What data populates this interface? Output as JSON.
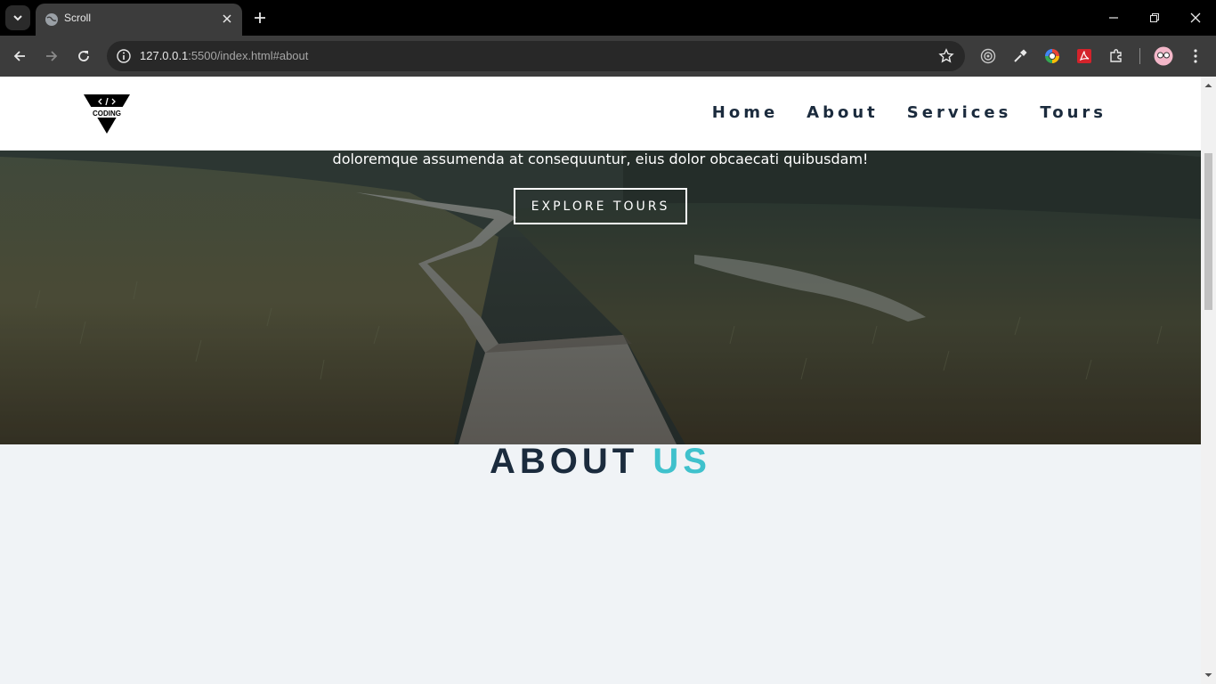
{
  "browser": {
    "tab_title": "Scroll",
    "url_host": "127.0.0.1",
    "url_rest": ":5500/index.html#about"
  },
  "navbar": {
    "logo_text": "CODING",
    "links": [
      "Home",
      "About",
      "Services",
      "Tours"
    ]
  },
  "hero": {
    "text": "doloremque assumenda at consequuntur, eius dolor obcaecati quibusdam!",
    "button_label": "EXPLORE TOURS"
  },
  "about": {
    "title_part1": "ABOUT",
    "title_part2": "US"
  },
  "colors": {
    "nav_text": "#1b2b3d",
    "accent": "#3fc1cc",
    "page_bg": "#f0f3f6"
  }
}
